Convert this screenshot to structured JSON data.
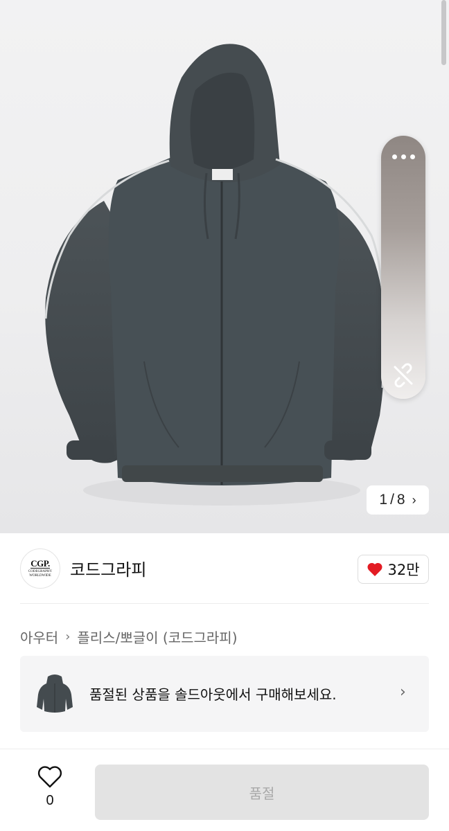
{
  "gallery": {
    "current_page": "1",
    "separator": "/",
    "total_pages": "8",
    "next_icon": "chevron-right-icon"
  },
  "floating_actions": {
    "more_icon": "more-dots-icon",
    "unlink_icon": "unlink-icon"
  },
  "brand": {
    "logo_line1": "CGP.",
    "logo_line2": "CODEGRAPHY",
    "logo_line3": "WORLDWIDE",
    "name": "코드그라피",
    "like_count": "32만",
    "like_color": "#e31b23"
  },
  "breadcrumb": {
    "items": [
      "아우터",
      "플리스/뽀글이 (코드그라피)"
    ]
  },
  "soldout_banner": {
    "text": "품절된 상품을 솔드아웃에서 구매해보세요."
  },
  "bottom_bar": {
    "wish_count": "0",
    "buy_label": "품절"
  }
}
